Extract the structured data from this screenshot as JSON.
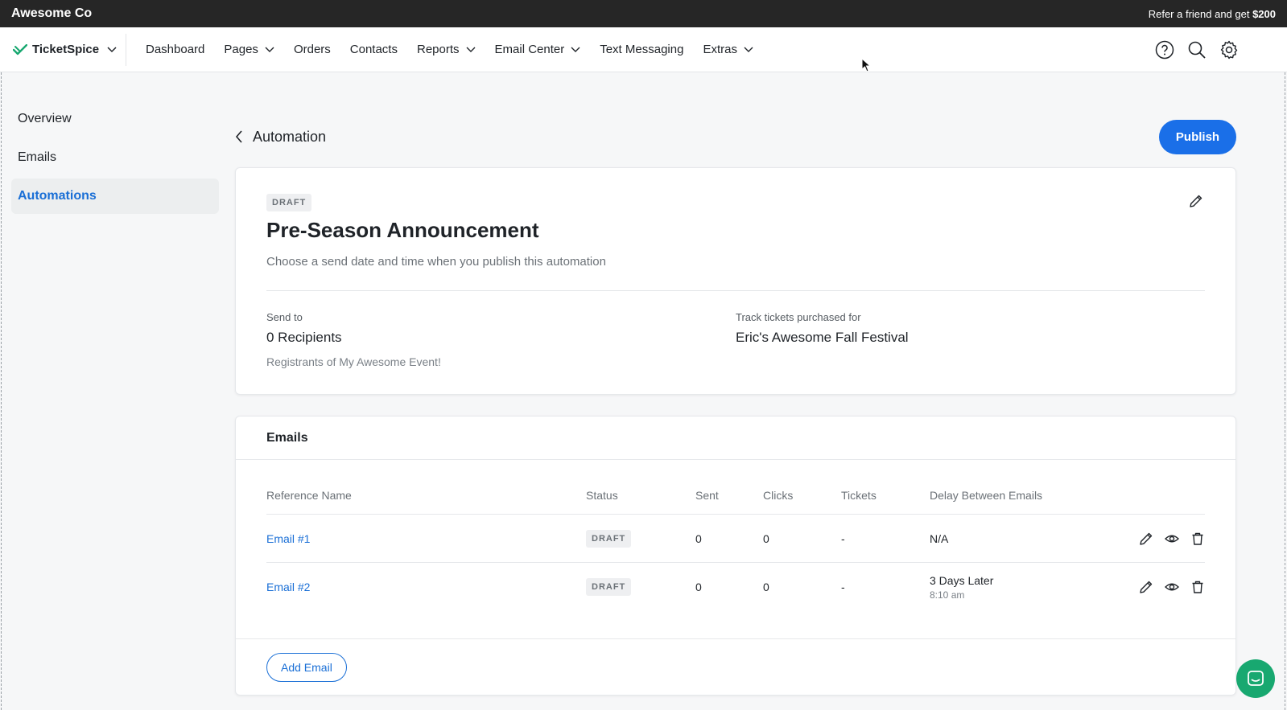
{
  "topbar": {
    "org_name": "Awesome Co",
    "refer_text": "Refer a friend and get ",
    "refer_amount": "$200"
  },
  "nav": {
    "brand": "TicketSpice",
    "items": [
      {
        "label": "Dashboard",
        "dropdown": false
      },
      {
        "label": "Pages",
        "dropdown": true
      },
      {
        "label": "Orders",
        "dropdown": false
      },
      {
        "label": "Contacts",
        "dropdown": false
      },
      {
        "label": "Reports",
        "dropdown": true
      },
      {
        "label": "Email Center",
        "dropdown": true
      },
      {
        "label": "Text Messaging",
        "dropdown": false
      },
      {
        "label": "Extras",
        "dropdown": true
      }
    ],
    "icons": [
      "help-icon",
      "search-icon",
      "gear-icon"
    ]
  },
  "sidebar": {
    "items": [
      {
        "label": "Overview",
        "active": false
      },
      {
        "label": "Emails",
        "active": false
      },
      {
        "label": "Automations",
        "active": true
      }
    ]
  },
  "header": {
    "back_label": "Automation",
    "publish_label": "Publish"
  },
  "automation": {
    "status": "DRAFT",
    "title": "Pre-Season Announcement",
    "subtitle": "Choose a send date and time when you publish this automation",
    "send_to_label": "Send to",
    "recipients": "0 Recipients",
    "recipients_note": "Registrants of My Awesome Event!",
    "track_label": "Track tickets purchased for",
    "track_value": "Eric's Awesome Fall Festival"
  },
  "emails": {
    "section_title": "Emails",
    "columns": [
      "Reference Name",
      "Status",
      "Sent",
      "Clicks",
      "Tickets",
      "Delay Between Emails"
    ],
    "rows": [
      {
        "name": "Email #1",
        "status": "DRAFT",
        "sent": "0",
        "clicks": "0",
        "tickets": "-",
        "delay": "N/A",
        "delay_sub": ""
      },
      {
        "name": "Email #2",
        "status": "DRAFT",
        "sent": "0",
        "clicks": "0",
        "tickets": "-",
        "delay": "3 Days Later",
        "delay_sub": "8:10 am"
      }
    ],
    "add_label": "Add Email"
  },
  "colors": {
    "accent": "#1a6fe8",
    "topbar": "#262626",
    "chat": "#18a870",
    "active_bg": "#eceeef"
  }
}
